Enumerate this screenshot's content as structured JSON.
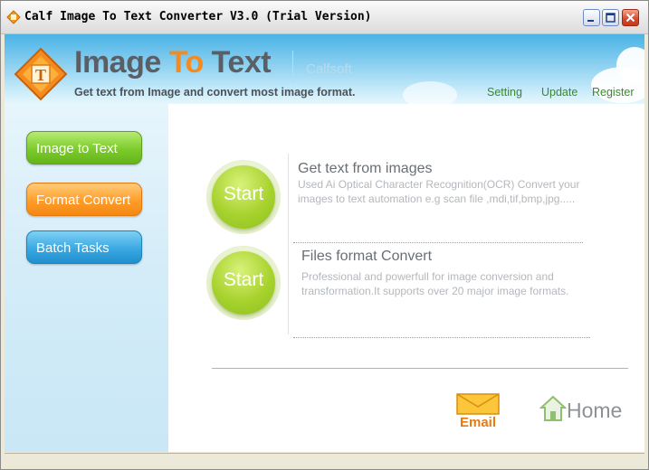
{
  "window": {
    "title": "Calf Image To Text Converter V3.0 (Trial Version)"
  },
  "header": {
    "title_part1": "Image ",
    "title_part2": "To",
    "title_part3": " Text",
    "brand": "Calfsoft",
    "tagline": "Get text from Image and convert most image format.",
    "links": {
      "setting": "Setting",
      "update": "Update",
      "register": "Register"
    }
  },
  "sidebar": {
    "items": [
      {
        "label": "Image to Text",
        "color": "#7ccb2b"
      },
      {
        "label": "Format Convert",
        "color": "#ff9d2a"
      },
      {
        "label": "Batch Tasks",
        "color": "#3aa8e2"
      }
    ]
  },
  "main": {
    "sections": [
      {
        "button": "Start",
        "title": "Get text from images",
        "description": "Used Ai Optical Character Recognition(OCR) Convert your images to text automation e.g scan file ,mdi,tif,bmp,jpg....."
      },
      {
        "button": "Start",
        "title": "Files format Convert",
        "description": "Professional and powerfull for image conversion and transformation.It supports over 20 major image formats."
      }
    ],
    "email_label": "Email",
    "home_label": "Home"
  },
  "icons": {
    "logo": "calf-logo-icon",
    "email": "envelope-icon",
    "home": "house-icon"
  }
}
